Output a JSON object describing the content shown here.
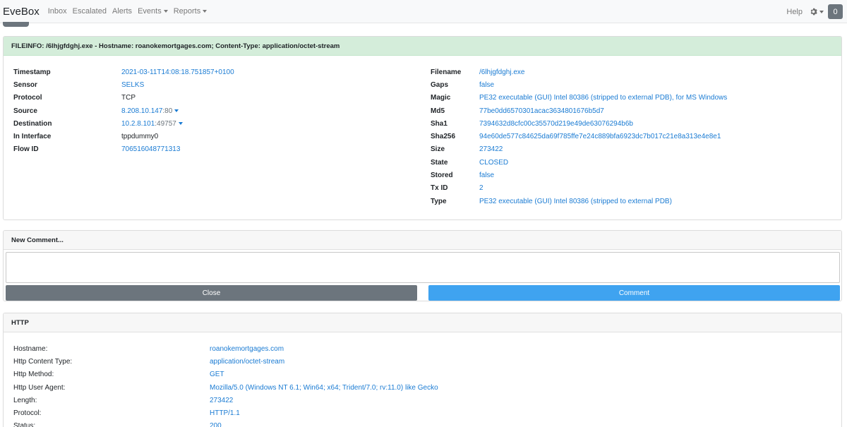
{
  "navbar": {
    "brand": "EveBox",
    "links": [
      "Inbox",
      "Escalated",
      "Alerts"
    ],
    "events_label": "Events",
    "reports_label": "Reports",
    "help_label": "Help",
    "gear_icon": "gear-icon",
    "count": "0"
  },
  "fileinfo": {
    "header": "FILEINFO: /6lhjgfdghj.exe - Hostname: roanokemortgages.com; Content-Type: application/octet-stream",
    "timestamp_label": "Timestamp",
    "timestamp": "2021-03-11T14:08:18.751857+0100",
    "sensor_label": "Sensor",
    "sensor": "SELKS",
    "protocol_label": "Protocol",
    "protocol": "TCP",
    "source_label": "Source",
    "source_ip": "8.208.10.147",
    "source_port": ":80",
    "destination_label": "Destination",
    "destination_ip": "10.2.8.101",
    "destination_port": ":49757",
    "in_interface_label": "In Interface",
    "in_interface": "tppdummy0",
    "flow_id_label": "Flow ID",
    "flow_id": "706516048771313",
    "filename_label": "Filename",
    "filename": "/6lhjgfdghj.exe",
    "gaps_label": "Gaps",
    "gaps": "false",
    "magic_label": "Magic",
    "magic": "PE32 executable (GUI) Intel 80386 (stripped to external PDB), for MS Windows",
    "md5_label": "Md5",
    "md5": "77be0dd6570301acac3634801676b5d7",
    "sha1_label": "Sha1",
    "sha1": "7394632d8cfc00c35570d219e49de63076294b6b",
    "sha256_label": "Sha256",
    "sha256": "94e60de577c84625da69f785ffe7e24c889bfa6923dc7b017c21e8a313e4e8e1",
    "size_label": "Size",
    "size": "273422",
    "state_label": "State",
    "state": "CLOSED",
    "stored_label": "Stored",
    "stored": "false",
    "tx_id_label": "Tx ID",
    "tx_id": "2",
    "type_label": "Type",
    "type": "PE32 executable (GUI) Intel 80386 (stripped to external PDB)"
  },
  "comment": {
    "header": "New Comment...",
    "close_label": "Close",
    "comment_label": "Comment"
  },
  "http": {
    "header": "HTTP",
    "hostname_label": "Hostname:",
    "hostname": "roanokemortgages.com",
    "content_type_label": "Http Content Type:",
    "content_type": "application/octet-stream",
    "method_label": "Http Method:",
    "method": "GET",
    "user_agent_label": "Http User Agent:",
    "user_agent": "Mozilla/5.0 (Windows NT 6.1; Win64; x64; Trident/7.0; rv:11.0) like Gecko",
    "length_label": "Length:",
    "length": "273422",
    "protocol_label": "Protocol:",
    "protocol": "HTTP/1.1",
    "status_label": "Status:",
    "status": "200"
  }
}
